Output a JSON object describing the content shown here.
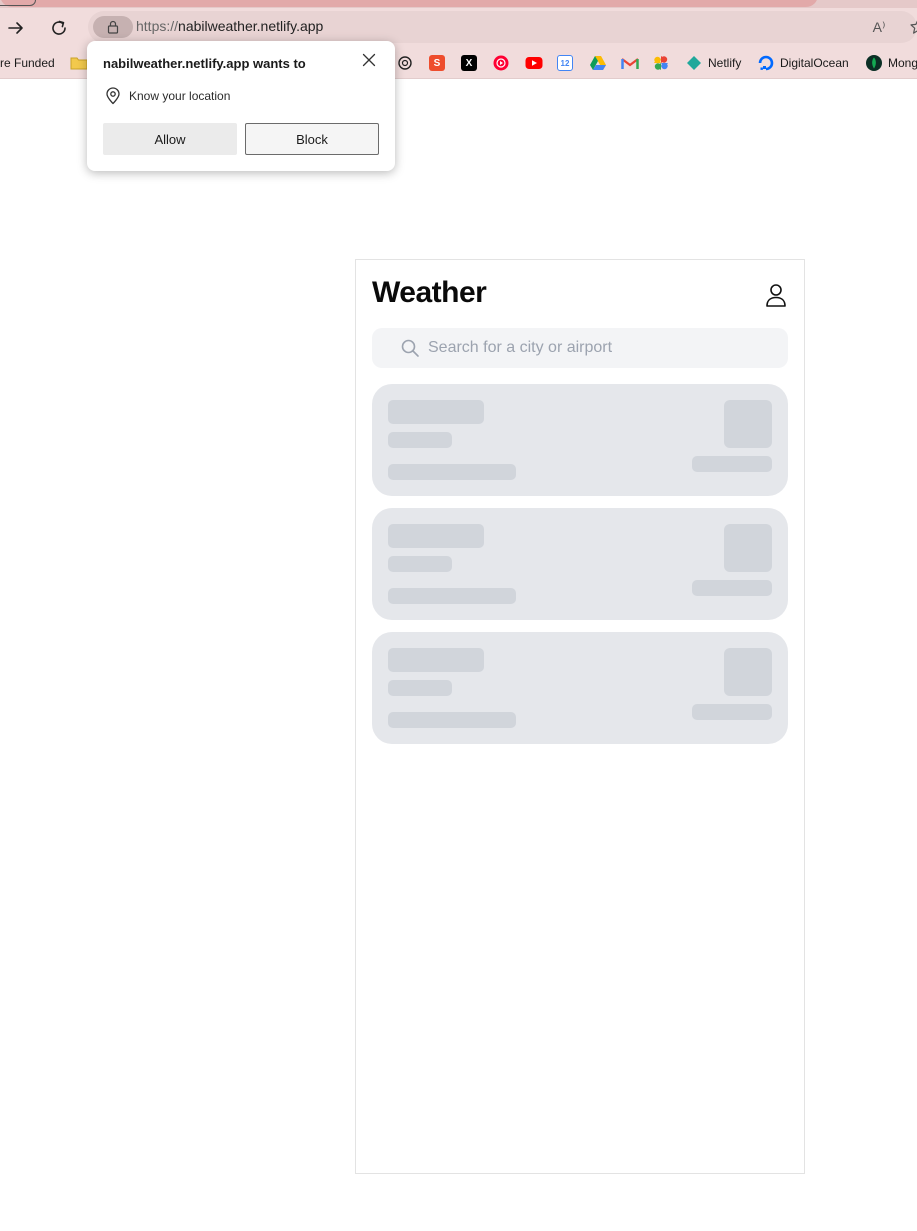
{
  "browser": {
    "url_scheme": "https://",
    "url_host": "nabilweather.netlify.app",
    "read_aloud_label": "A⁾",
    "bookmarks": [
      {
        "label": "re Funded",
        "icon": "none"
      },
      {
        "label": "",
        "icon": "folder-icon"
      },
      {
        "label": "",
        "icon": "chatgpt-icon"
      },
      {
        "label": "",
        "icon": "shopee-icon"
      },
      {
        "label": "",
        "icon": "x-icon"
      },
      {
        "label": "",
        "icon": "youtube-music-icon"
      },
      {
        "label": "",
        "icon": "youtube-icon"
      },
      {
        "label": "",
        "icon": "calendar-icon"
      },
      {
        "label": "",
        "icon": "google-drive-icon"
      },
      {
        "label": "",
        "icon": "gmail-icon"
      },
      {
        "label": "",
        "icon": "google-photos-icon"
      },
      {
        "label": "Netlify",
        "icon": "netlify-icon"
      },
      {
        "label": "DigitalOcean",
        "icon": "digitalocean-icon"
      },
      {
        "label": "Mong",
        "icon": "mongodb-icon"
      }
    ],
    "calendar_day": "12"
  },
  "permission": {
    "title": "nabilweather.netlify.app wants to",
    "request": "Know your location",
    "allow_label": "Allow",
    "block_label": "Block"
  },
  "app": {
    "title": "Weather",
    "search_placeholder": "Search for a city or airport",
    "loading_cards": 3
  }
}
